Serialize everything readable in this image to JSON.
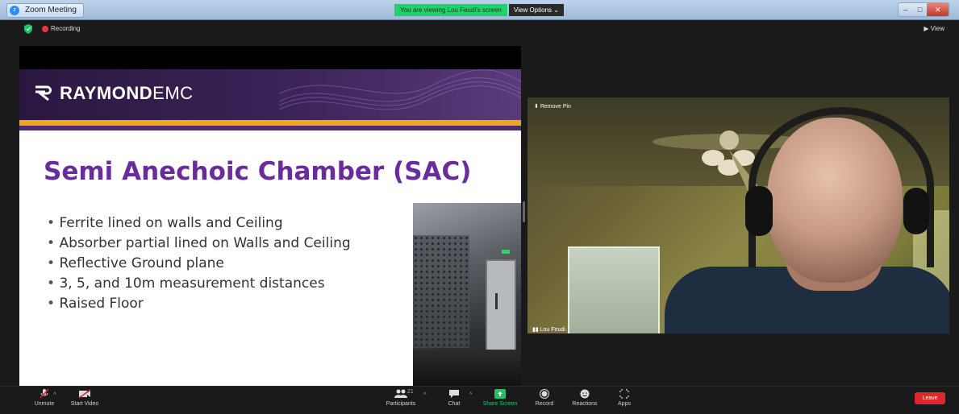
{
  "window": {
    "title": "Zoom Meeting",
    "logo_glyph": "z",
    "viewing_banner": "You are viewing Lou Feudi's screen",
    "view_options": "View Options  ⌄",
    "controls": {
      "minimize": "–",
      "maximize": "□",
      "close": "✕"
    }
  },
  "topbar": {
    "recording_label": "Recording",
    "view_label": "▶ View"
  },
  "slide": {
    "logo_bold": "RAYMOND",
    "logo_light": "EMC",
    "title": "Semi Anechoic Chamber (SAC)",
    "bullets": [
      "Ferrite lined on walls and Ceiling",
      "Absorber partial lined on Walls and Ceiling",
      "Reflective Ground plane",
      "3, 5, and 10m measurement distances",
      "Raised Floor"
    ]
  },
  "video": {
    "remove_pin": "Remove Pin",
    "participant_name": "Lou Feudi"
  },
  "toolbar": {
    "unmute": "Unmute",
    "start_video": "Start Video",
    "participants": "Participants",
    "participants_count": "21",
    "chat": "Chat",
    "share_screen": "Share Screen",
    "record": "Record",
    "reactions": "Reactions",
    "apps": "Apps",
    "leave": "Leave"
  },
  "colors": {
    "share_green": "#21c267",
    "leave_red": "#e02828",
    "slide_purple": "#6a2c9a",
    "slide_gold": "#f2a51d"
  }
}
